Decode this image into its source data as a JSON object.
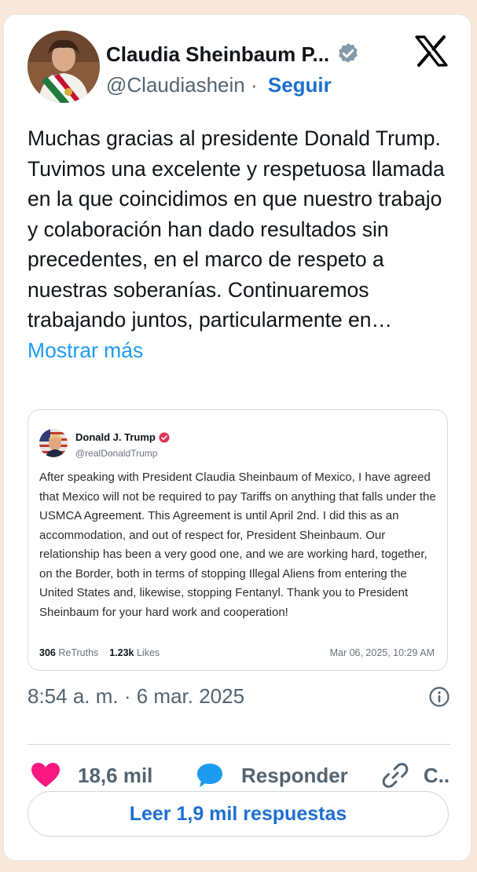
{
  "tweet": {
    "author_name": "Claudia Sheinbaum P...",
    "author_handle": "@Claudiashein",
    "separator": "·",
    "follow_label": "Seguir",
    "text": "Muchas gracias al presidente Donald Trump. Tuvimos una excelente y respetuosa llamada en la que coincidimos en que nuestro trabajo y colaboración han dado resultados sin precedentes, en el marco de respeto a nuestras soberanías. Continuaremos trabajando juntos, particularmente en…",
    "show_more_label": "Mostrar más",
    "timestamp": "8:54 a. m. · 6 mar. 2025"
  },
  "quoted_post": {
    "author_name": "Donald J. Trump",
    "author_handle": "@realDonaldTrump",
    "text": "After speaking with President Claudia Sheinbaum of Mexico, I have agreed that Mexico will not be required to pay Tariffs on anything that falls under the USMCA Agreement. This Agreement is until April 2nd. I did this as an accommodation, and out of respect for, President Sheinbaum. Our relationship has been a very good one, and we are working hard, together, on the Border, both in terms of stopping Illegal Aliens from entering the United States and, likewise, stopping Fentanyl. Thank you to President Sheinbaum for your hard work and cooperation!",
    "retruths_count": "306",
    "retruths_label": "ReTruths",
    "likes_count": "1.23k",
    "likes_label": "Likes",
    "date": "Mar 06, 2025, 10:29 AM"
  },
  "actions": {
    "like_count": "18,6 mil",
    "reply_label": "Responder",
    "copy_label": "C.."
  },
  "read_replies_label": "Leer 1,9 mil respuestas",
  "colors": {
    "page_background": "#f9e8d9",
    "link_blue": "#1d6fd1",
    "show_more_blue": "#1d9bf0",
    "secondary_text": "#536471",
    "like_pink": "#f91880",
    "reply_blue": "#1d9bf0",
    "verified_gray": "#829aab",
    "truth_badge_red": "#e2335a"
  },
  "icons": [
    "verified-badge-icon",
    "x-logo-icon",
    "truth-verified-icon",
    "info-icon",
    "heart-icon",
    "reply-bubble-icon",
    "link-icon"
  ]
}
